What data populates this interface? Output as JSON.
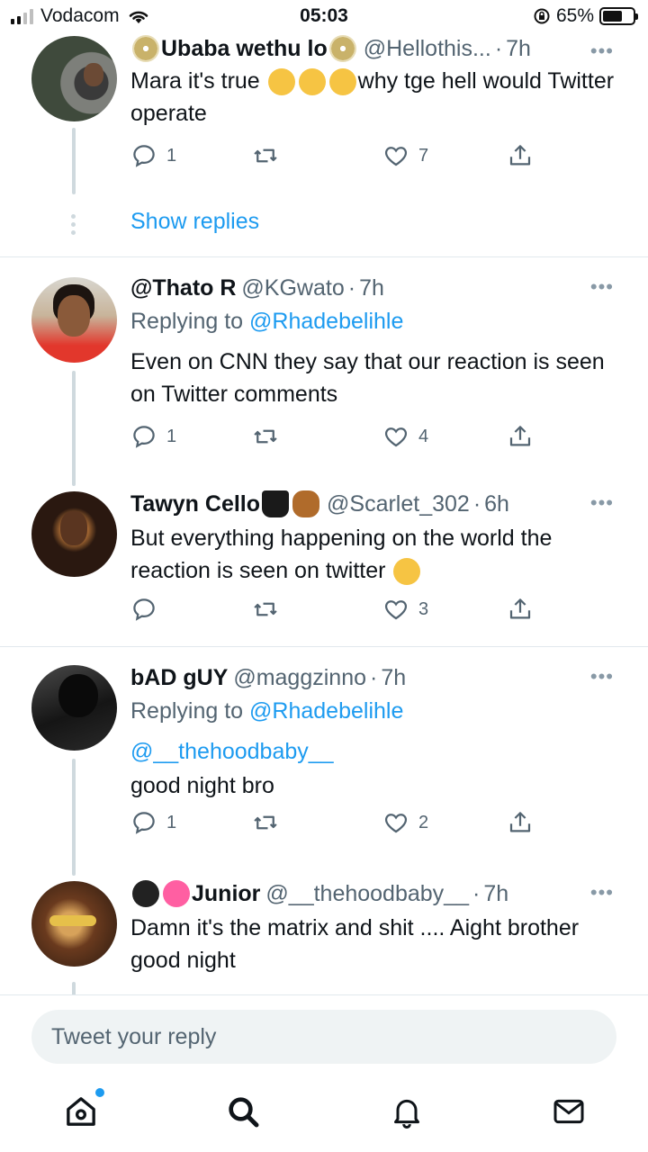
{
  "status_bar": {
    "carrier": "Vodacom",
    "time": "05:03",
    "battery_percent": "65%",
    "battery_level": 0.65
  },
  "tweets": [
    {
      "name": "Ubaba wethu lo",
      "handle": "@Hellothis...",
      "time": "7h",
      "text": "Mara it's true",
      "text_after_emoji": "why tge hell would Twitter operate",
      "replies": "1",
      "likes": "7",
      "show_replies": "Show replies"
    },
    {
      "name": "@Thato R",
      "handle": "@KGwato",
      "time": "7h",
      "replying_label": "Replying to",
      "replying_to": "@Rhadebelihle",
      "text": "Even on CNN they say that our reaction is seen on Twitter comments",
      "replies": "1",
      "likes": "4"
    },
    {
      "name": "Tawyn Cello",
      "handle": "@Scarlet_302",
      "time": "6h",
      "text": "But everything happening on the world the reaction is seen on twitter",
      "likes": "3"
    },
    {
      "name": "bAD gUY",
      "handle": "@maggzinno",
      "time": "7h",
      "replying_label": "Replying to",
      "replying_to": "@Rhadebelihle",
      "mention": "@__thehoodbaby__",
      "text": "good night bro",
      "replies": "1",
      "likes": "2"
    },
    {
      "name": "Junior",
      "handle": "@__thehoodbaby__",
      "time": "7h",
      "text": "Damn it's the matrix and shit .... Aight brother good night"
    }
  ],
  "reply_box": {
    "placeholder": "Tweet your reply"
  },
  "tab_bar": {
    "icons": [
      "home-icon",
      "search-icon",
      "bell-icon",
      "mail-icon"
    ]
  },
  "colors": {
    "accent": "#1d9bf0",
    "muted": "#536471",
    "text": "#0f1419"
  }
}
